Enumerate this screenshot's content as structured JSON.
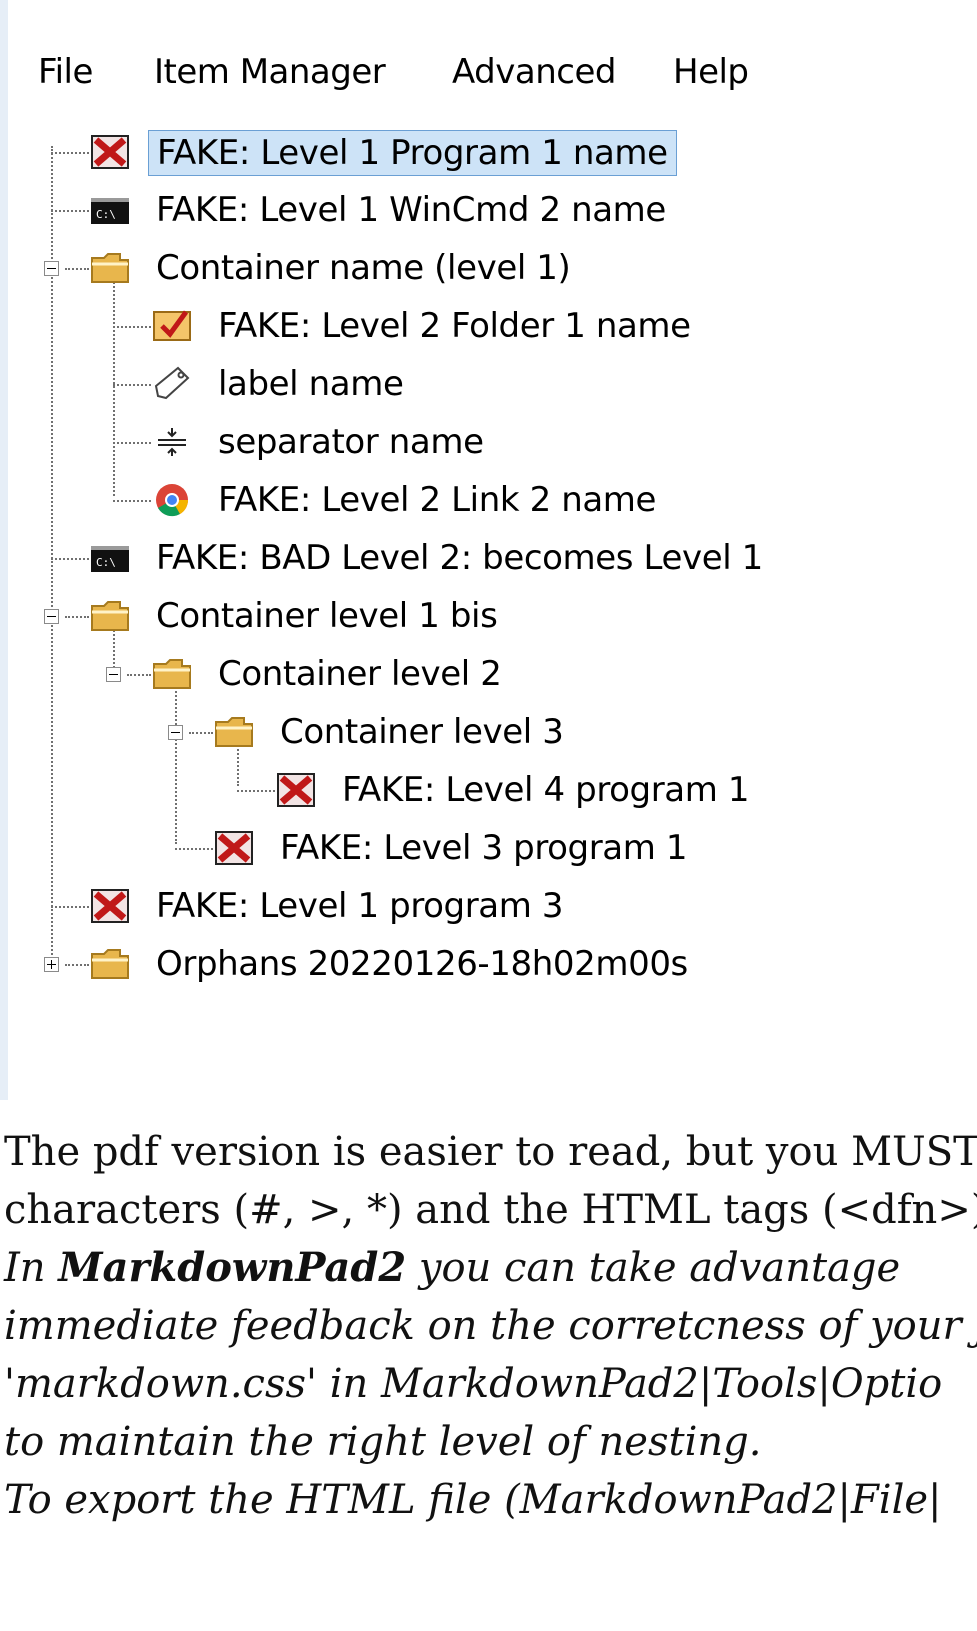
{
  "menu": {
    "file": "File",
    "item_manager": "Item Manager",
    "advanced": "Advanced",
    "help": "Help"
  },
  "tree": {
    "items": [
      {
        "label": "FAKE: Level 1 Program 1 name",
        "icon": "program-error-icon",
        "selected": true
      },
      {
        "label": "FAKE: Level 1 WinCmd 2 name",
        "icon": "cmd-icon"
      },
      {
        "label": "Container name (level 1)",
        "icon": "folder-icon",
        "expanded": true
      },
      {
        "label": "FAKE: Level 2 Folder 1 name",
        "icon": "checked-folder-icon"
      },
      {
        "label": "label name",
        "icon": "tag-icon"
      },
      {
        "label": "separator name",
        "icon": "separator-icon"
      },
      {
        "label": "FAKE: Level 2 Link 2 name",
        "icon": "chrome-icon"
      },
      {
        "label": "FAKE: BAD Level 2: becomes Level 1",
        "icon": "cmd-icon"
      },
      {
        "label": "Container level 1 bis",
        "icon": "folder-icon",
        "expanded": true
      },
      {
        "label": "Container level 2",
        "icon": "folder-icon",
        "expanded": true
      },
      {
        "label": "Container level 3",
        "icon": "folder-icon",
        "expanded": true
      },
      {
        "label": "FAKE: Level 4 program 1",
        "icon": "program-error-icon"
      },
      {
        "label": "FAKE: Level 3 program 1",
        "icon": "program-error-icon"
      },
      {
        "label": "FAKE: Level 1 program 3",
        "icon": "program-error-icon"
      },
      {
        "label": "Orphans 20220126-18h02m00s",
        "icon": "folder-icon",
        "expanded": false
      }
    ]
  },
  "doc": {
    "line1": "The pdf version is easier to read, but you MUST",
    "line2": "characters (#, >, *) and the HTML tags (<dfn>).",
    "line3_prefix": "In ",
    "line3_bold": "MarkdownPad2",
    "line3_rest": " you can take advantage",
    "line4": "immediate feedback on the corretcness of your j",
    "line5": "'markdown.css' in MarkdownPad2|Tools|Optio",
    "line6": "to maintain the right level of nesting.",
    "line7": "To export the HTML file (MarkdownPad2|File|"
  }
}
